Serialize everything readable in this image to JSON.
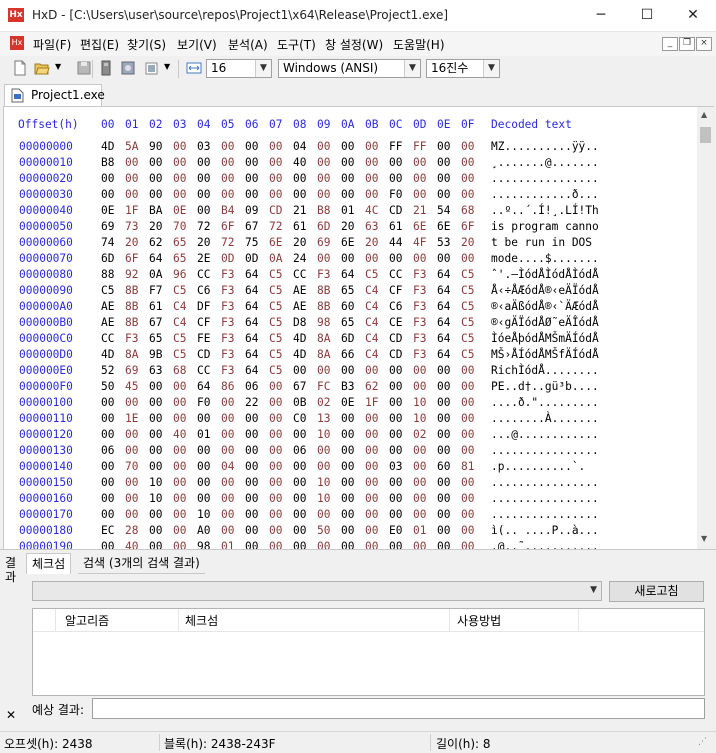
{
  "window": {
    "app_name": "HxD",
    "title": "HxD - [C:\\Users\\user\\source\\repos\\Project1\\x64\\Release\\Project1.exe]",
    "minimize": "─",
    "maximize": "☐",
    "close": "✕"
  },
  "menu": [
    "파일(F)",
    "편집(E)",
    "찾기(S)",
    "보기(V)",
    "분석(A)",
    "도구(T)",
    "창 설정(W)",
    "도움말(H)"
  ],
  "toolbar": {
    "bytes_per_row": "16",
    "charset": "Windows (ANSI)",
    "offset_base": "16진수"
  },
  "tab": {
    "label": "Project1.exe"
  },
  "hex_view": {
    "offset_header": "Offset(h)",
    "columns": [
      "00",
      "01",
      "02",
      "03",
      "04",
      "05",
      "06",
      "07",
      "08",
      "09",
      "0A",
      "0B",
      "0C",
      "0D",
      "0E",
      "0F"
    ],
    "decoded_header": "Decoded text",
    "rows": [
      {
        "offset": "00000000",
        "bytes": [
          "4D",
          "5A",
          "90",
          "00",
          "03",
          "00",
          "00",
          "00",
          "04",
          "00",
          "00",
          "00",
          "FF",
          "FF",
          "00",
          "00"
        ],
        "text": "MZ..........ÿÿ.."
      },
      {
        "offset": "00000010",
        "bytes": [
          "B8",
          "00",
          "00",
          "00",
          "00",
          "00",
          "00",
          "00",
          "40",
          "00",
          "00",
          "00",
          "00",
          "00",
          "00",
          "00"
        ],
        "text": "¸.......@......."
      },
      {
        "offset": "00000020",
        "bytes": [
          "00",
          "00",
          "00",
          "00",
          "00",
          "00",
          "00",
          "00",
          "00",
          "00",
          "00",
          "00",
          "00",
          "00",
          "00",
          "00"
        ],
        "text": "................"
      },
      {
        "offset": "00000030",
        "bytes": [
          "00",
          "00",
          "00",
          "00",
          "00",
          "00",
          "00",
          "00",
          "00",
          "00",
          "00",
          "00",
          "F0",
          "00",
          "00",
          "00"
        ],
        "text": "............ð..."
      },
      {
        "offset": "00000040",
        "bytes": [
          "0E",
          "1F",
          "BA",
          "0E",
          "00",
          "B4",
          "09",
          "CD",
          "21",
          "B8",
          "01",
          "4C",
          "CD",
          "21",
          "54",
          "68"
        ],
        "text": "..º..´.Í!¸.LÍ!Th"
      },
      {
        "offset": "00000050",
        "bytes": [
          "69",
          "73",
          "20",
          "70",
          "72",
          "6F",
          "67",
          "72",
          "61",
          "6D",
          "20",
          "63",
          "61",
          "6E",
          "6E",
          "6F"
        ],
        "text": "is program canno"
      },
      {
        "offset": "00000060",
        "bytes": [
          "74",
          "20",
          "62",
          "65",
          "20",
          "72",
          "75",
          "6E",
          "20",
          "69",
          "6E",
          "20",
          "44",
          "4F",
          "53",
          "20"
        ],
        "text": "t be run in DOS "
      },
      {
        "offset": "00000070",
        "bytes": [
          "6D",
          "6F",
          "64",
          "65",
          "2E",
          "0D",
          "0D",
          "0A",
          "24",
          "00",
          "00",
          "00",
          "00",
          "00",
          "00",
          "00"
        ],
        "text": "mode....$......."
      },
      {
        "offset": "00000080",
        "bytes": [
          "88",
          "92",
          "0A",
          "96",
          "CC",
          "F3",
          "64",
          "C5",
          "CC",
          "F3",
          "64",
          "C5",
          "CC",
          "F3",
          "64",
          "C5"
        ],
        "text": "ˆ'.–ÌódÅÌódÅÌódÅ"
      },
      {
        "offset": "00000090",
        "bytes": [
          "C5",
          "8B",
          "F7",
          "C5",
          "C6",
          "F3",
          "64",
          "C5",
          "AE",
          "8B",
          "65",
          "C4",
          "CF",
          "F3",
          "64",
          "C5"
        ],
        "text": "Å‹÷ÅÆódÅ®‹eÄÏódÅ"
      },
      {
        "offset": "000000A0",
        "bytes": [
          "AE",
          "8B",
          "61",
          "C4",
          "DF",
          "F3",
          "64",
          "C5",
          "AE",
          "8B",
          "60",
          "C4",
          "C6",
          "F3",
          "64",
          "C5"
        ],
        "text": "®‹aÄßódÅ®‹`ÄÆódÅ"
      },
      {
        "offset": "000000B0",
        "bytes": [
          "AE",
          "8B",
          "67",
          "C4",
          "CF",
          "F3",
          "64",
          "C5",
          "D8",
          "98",
          "65",
          "C4",
          "CE",
          "F3",
          "64",
          "C5"
        ],
        "text": "®‹gÄÏódÅØ˜eÄÎódÅ"
      },
      {
        "offset": "000000C0",
        "bytes": [
          "CC",
          "F3",
          "65",
          "C5",
          "FE",
          "F3",
          "64",
          "C5",
          "4D",
          "8A",
          "6D",
          "C4",
          "CD",
          "F3",
          "64",
          "C5"
        ],
        "text": "ÌóeÅþódÅMŠmÄÍódÅ"
      },
      {
        "offset": "000000D0",
        "bytes": [
          "4D",
          "8A",
          "9B",
          "C5",
          "CD",
          "F3",
          "64",
          "C5",
          "4D",
          "8A",
          "66",
          "C4",
          "CD",
          "F3",
          "64",
          "C5"
        ],
        "text": "MŠ›ÅÍódÅMŠfÄÍódÅ"
      },
      {
        "offset": "000000E0",
        "bytes": [
          "52",
          "69",
          "63",
          "68",
          "CC",
          "F3",
          "64",
          "C5",
          "00",
          "00",
          "00",
          "00",
          "00",
          "00",
          "00",
          "00"
        ],
        "text": "RichÌódÅ........"
      },
      {
        "offset": "000000F0",
        "bytes": [
          "50",
          "45",
          "00",
          "00",
          "64",
          "86",
          "06",
          "00",
          "67",
          "FC",
          "B3",
          "62",
          "00",
          "00",
          "00",
          "00"
        ],
        "text": "PE..d†..gü³b...."
      },
      {
        "offset": "00000100",
        "bytes": [
          "00",
          "00",
          "00",
          "00",
          "F0",
          "00",
          "22",
          "00",
          "0B",
          "02",
          "0E",
          "1F",
          "00",
          "10",
          "00",
          "00"
        ],
        "text": "....ð.\"........."
      },
      {
        "offset": "00000110",
        "bytes": [
          "00",
          "1E",
          "00",
          "00",
          "00",
          "00",
          "00",
          "00",
          "C0",
          "13",
          "00",
          "00",
          "00",
          "10",
          "00",
          "00"
        ],
        "text": "........À......."
      },
      {
        "offset": "00000120",
        "bytes": [
          "00",
          "00",
          "00",
          "40",
          "01",
          "00",
          "00",
          "00",
          "00",
          "10",
          "00",
          "00",
          "00",
          "02",
          "00",
          "00"
        ],
        "text": "...@............"
      },
      {
        "offset": "00000130",
        "bytes": [
          "06",
          "00",
          "00",
          "00",
          "00",
          "00",
          "00",
          "00",
          "06",
          "00",
          "00",
          "00",
          "00",
          "00",
          "00",
          "00"
        ],
        "text": "................"
      },
      {
        "offset": "00000140",
        "bytes": [
          "00",
          "70",
          "00",
          "00",
          "00",
          "04",
          "00",
          "00",
          "00",
          "00",
          "00",
          "00",
          "03",
          "00",
          "60",
          "81"
        ],
        "text": ".p..........`."
      },
      {
        "offset": "00000150",
        "bytes": [
          "00",
          "00",
          "10",
          "00",
          "00",
          "00",
          "00",
          "00",
          "00",
          "10",
          "00",
          "00",
          "00",
          "00",
          "00",
          "00"
        ],
        "text": "................"
      },
      {
        "offset": "00000160",
        "bytes": [
          "00",
          "00",
          "10",
          "00",
          "00",
          "00",
          "00",
          "00",
          "00",
          "10",
          "00",
          "00",
          "00",
          "00",
          "00",
          "00"
        ],
        "text": "................"
      },
      {
        "offset": "00000170",
        "bytes": [
          "00",
          "00",
          "00",
          "00",
          "10",
          "00",
          "00",
          "00",
          "00",
          "00",
          "00",
          "00",
          "00",
          "00",
          "00",
          "00"
        ],
        "text": "................"
      },
      {
        "offset": "00000180",
        "bytes": [
          "EC",
          "28",
          "00",
          "00",
          "A0",
          "00",
          "00",
          "00",
          "00",
          "50",
          "00",
          "00",
          "E0",
          "01",
          "00",
          "00"
        ],
        "text": "ì(.. ....P..à..."
      },
      {
        "offset": "00000190",
        "bytes": [
          "00",
          "40",
          "00",
          "00",
          "98",
          "01",
          "00",
          "00",
          "00",
          "00",
          "00",
          "00",
          "00",
          "00",
          "00",
          "00"
        ],
        "text": ".@..˜..........."
      }
    ]
  },
  "results": {
    "side_label": "결과",
    "side_close": "✕",
    "tabs": [
      "체크섬",
      "검색 (3개의 검색 결과)"
    ],
    "refresh_button": "새로고침",
    "columns": [
      "알고리즘",
      "체크섬",
      "사용방법"
    ],
    "expected_label": "예상 결과:",
    "expected_value": ""
  },
  "status": {
    "offset": "오프셋(h): 2438",
    "block": "블록(h): 2438-243F",
    "length": "길이(h): 8"
  }
}
